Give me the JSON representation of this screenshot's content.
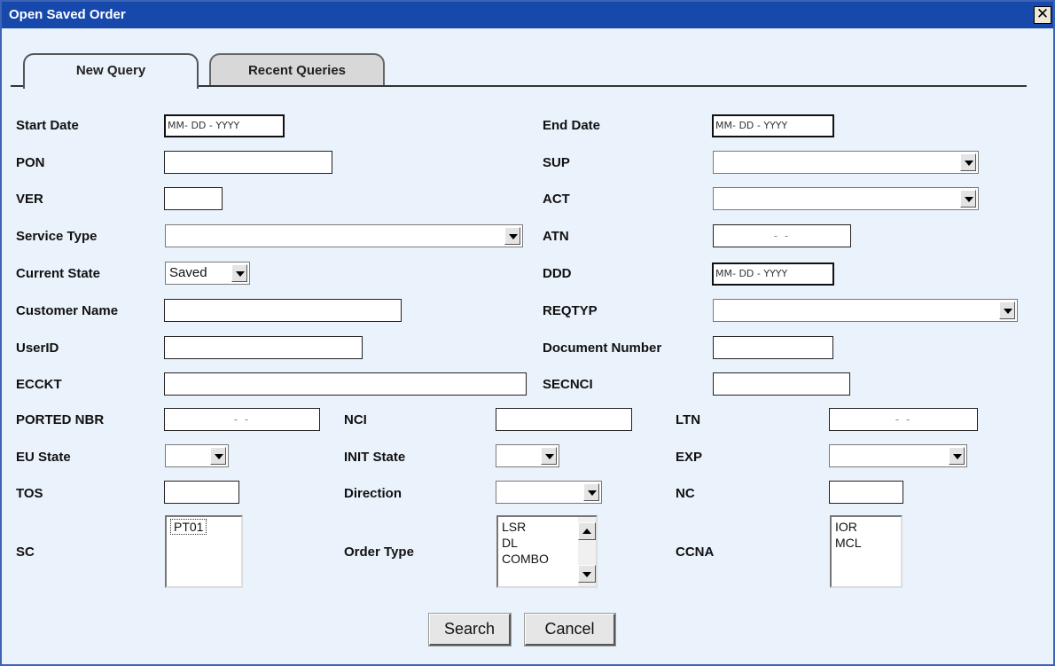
{
  "window": {
    "title": "Open Saved Order",
    "close_glyph": "✕"
  },
  "tabs": [
    {
      "label": "New Query",
      "active": true
    },
    {
      "label": "Recent Queries",
      "active": false
    }
  ],
  "form": {
    "start_date": {
      "label": "Start Date",
      "value": "MM- DD - YYYY"
    },
    "end_date": {
      "label": "End Date",
      "value": "MM- DD - YYYY"
    },
    "pon": {
      "label": "PON",
      "value": ""
    },
    "sup": {
      "label": "SUP",
      "value": ""
    },
    "ver": {
      "label": "VER",
      "value": ""
    },
    "act": {
      "label": "ACT",
      "value": ""
    },
    "service_type": {
      "label": "Service Type",
      "value": ""
    },
    "atn": {
      "label": "ATN",
      "value": "-    -"
    },
    "current_state": {
      "label": "Current State",
      "value": "Saved"
    },
    "ddd": {
      "label": "DDD",
      "value": "MM- DD - YYYY"
    },
    "customer_name": {
      "label": "Customer Name",
      "value": ""
    },
    "reqtyp": {
      "label": "REQTYP",
      "value": ""
    },
    "userid": {
      "label": "UserID",
      "value": ""
    },
    "document_number": {
      "label": "Document Number",
      "value": ""
    },
    "ecckt": {
      "label": "ECCKT",
      "value": ""
    },
    "secnci": {
      "label": "SECNCI",
      "value": ""
    },
    "ported_nbr": {
      "label": "PORTED NBR",
      "value": "-    -"
    },
    "nci": {
      "label": "NCI",
      "value": ""
    },
    "ltn": {
      "label": "LTN",
      "value": "-    -"
    },
    "eu_state": {
      "label": "EU State",
      "value": ""
    },
    "init_state": {
      "label": "INIT State",
      "value": ""
    },
    "exp": {
      "label": "EXP",
      "value": ""
    },
    "tos": {
      "label": "TOS",
      "value": ""
    },
    "direction": {
      "label": "Direction",
      "value": ""
    },
    "nc": {
      "label": "NC",
      "value": ""
    },
    "sc": {
      "label": "SC",
      "options": [
        "PT01"
      ]
    },
    "order_type": {
      "label": "Order Type",
      "options": [
        "LSR",
        "DL",
        "COMBO"
      ]
    },
    "ccna": {
      "label": "CCNA",
      "options": [
        "IOR",
        "MCL"
      ]
    }
  },
  "buttons": {
    "search": "Search",
    "cancel": "Cancel"
  },
  "colors": {
    "titlebar": "#1749ad",
    "dialog_bg": "#eaf2fb",
    "border": "#3c63b5"
  },
  "icons": {
    "close": "close-icon",
    "dropdown": "chevron-down-icon"
  }
}
